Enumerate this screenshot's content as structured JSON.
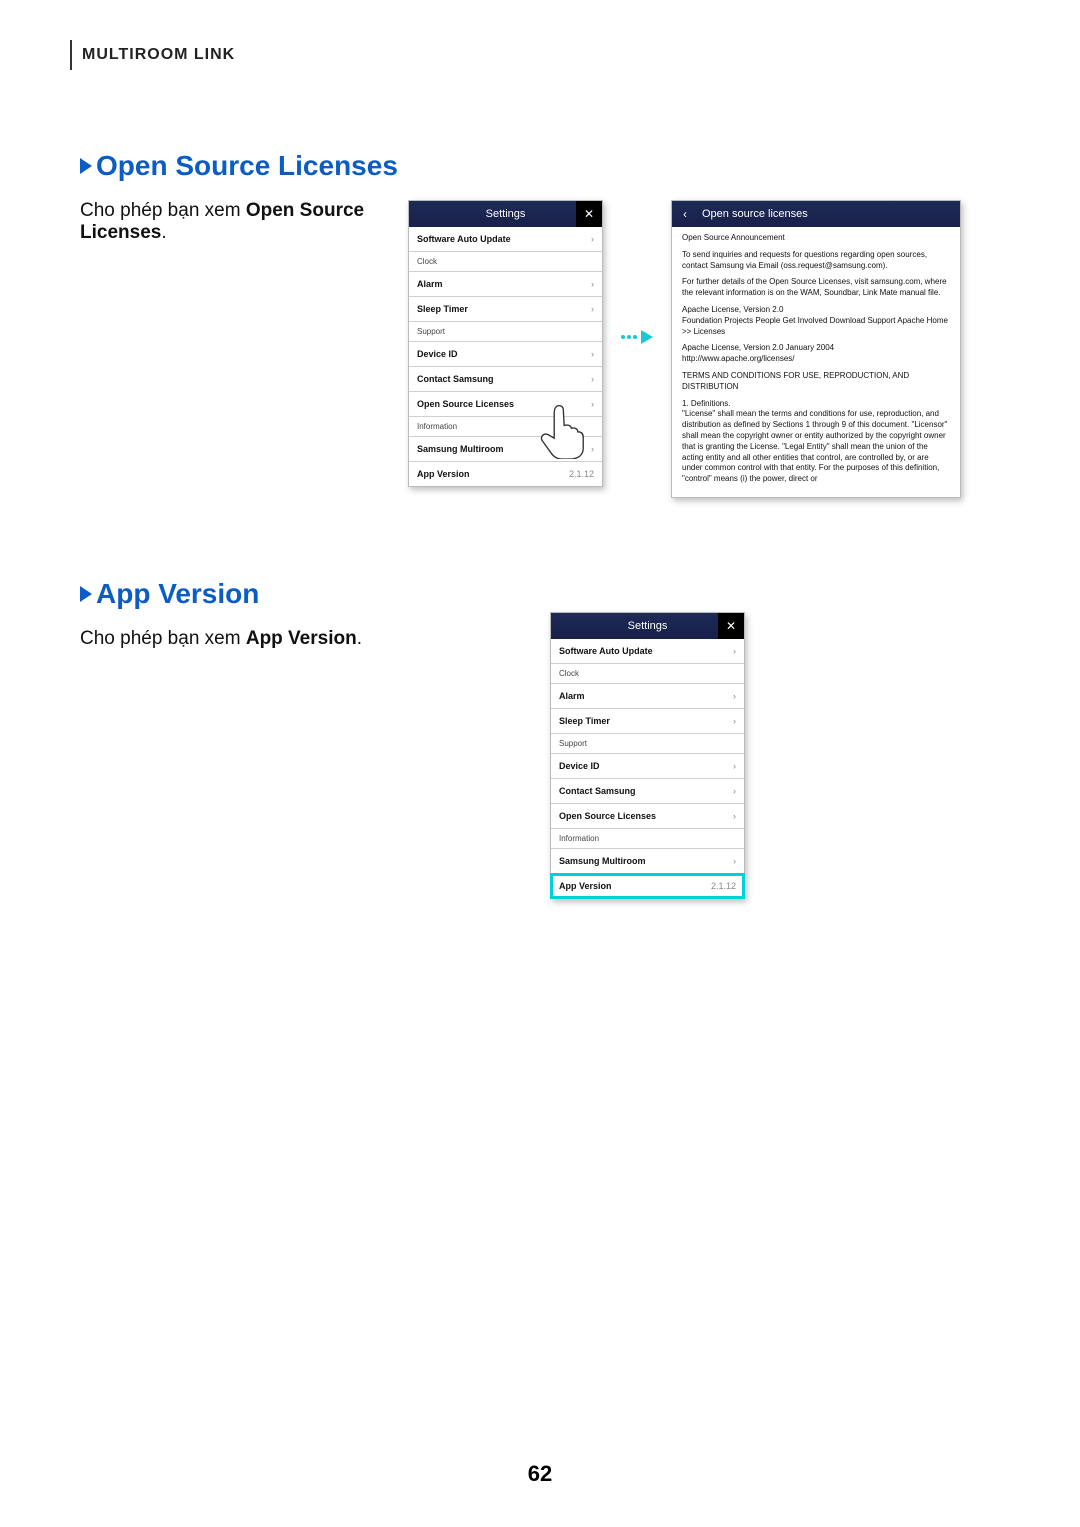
{
  "header": {
    "title": "MULTIROOM LINK"
  },
  "page_number": "62",
  "section1": {
    "title": "Open Source Licenses",
    "desc_pre": "Cho phép bạn xem ",
    "desc_bold": "Open Source Licenses",
    "desc_post": "."
  },
  "section2": {
    "title": "App Version",
    "desc_pre": "Cho phép bạn xem ",
    "desc_bold": "App Version",
    "desc_post": "."
  },
  "settings_panel": {
    "title": "Settings",
    "items": [
      {
        "label": "Software Auto Update",
        "chev": "›",
        "cat": false
      },
      {
        "label": "Clock",
        "chev": "",
        "cat": true
      },
      {
        "label": "Alarm",
        "chev": "›",
        "cat": false
      },
      {
        "label": "Sleep Timer",
        "chev": "›",
        "cat": false
      },
      {
        "label": "Support",
        "chev": "",
        "cat": true
      },
      {
        "label": "Device ID",
        "chev": "›",
        "cat": false
      },
      {
        "label": "Contact Samsung",
        "chev": "›",
        "cat": false
      },
      {
        "label": "Open Source Licenses",
        "chev": "›",
        "cat": false
      },
      {
        "label": "Information",
        "chev": "",
        "cat": true
      },
      {
        "label": "Samsung Multiroom",
        "chev": "›",
        "cat": false
      },
      {
        "label": "App Version",
        "chev": "2.1.12",
        "cat": false
      }
    ]
  },
  "oss_panel": {
    "title": "Open source licenses",
    "announce": "Open Source Announcement",
    "p1": "To send inquiries and requests for questions regarding open sources, contact Samsung via Email (oss.request@samsung.com).",
    "p2": "For further details of the Open Source Licenses, visit samsung.com, where the relevant information is on the WAM, Soundbar, Link Mate manual file.",
    "p3": "Apache License, Version 2.0\nFoundation Projects People Get Involved Download Support Apache Home >> Licenses",
    "p4": "Apache License, Version 2.0 January 2004\nhttp://www.apache.org/licenses/",
    "p5": "TERMS AND CONDITIONS FOR USE, REPRODUCTION, AND DISTRIBUTION",
    "p6": "1. Definitions.\n\"License\" shall mean the terms and conditions for use, reproduction, and distribution as defined by Sections 1 through 9 of this document. \"Licensor\" shall mean the copyright owner or entity authorized by the copyright owner that is granting the License. \"Legal Entity\" shall mean the union of the acting entity and all other entities that control, are controlled by, or are under common control with that entity. For the purposes of this definition, \"control\" means (i) the power, direct or"
  }
}
